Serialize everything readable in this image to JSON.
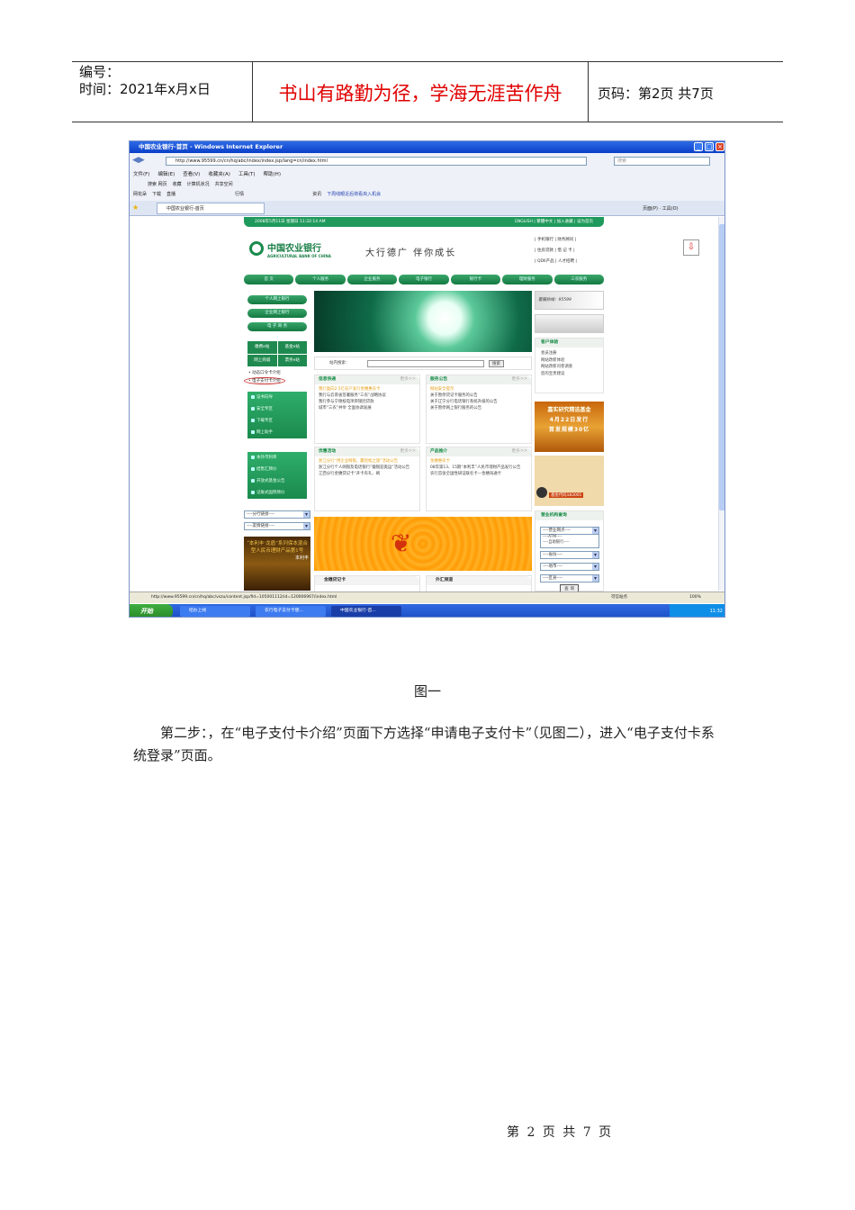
{
  "header": {
    "number_label": "编号：",
    "date_label": "时间：2021年x月x日",
    "motto": "书山有路勤为径，学海无涯苦作舟",
    "page_info": "页码：第2页  共7页"
  },
  "screenshot": {
    "window_title": "中国农业银行-首页 - Windows Internet Explorer",
    "address": "http://www.95599.cn/cn/hq/abc/index/index.jsp/lang=cn/index.html",
    "search_placeholder": "搜索",
    "menu": [
      "文件(F)",
      "编辑(E)",
      "查看(V)",
      "收藏夹(A)",
      "工具(T)",
      "帮助(H)"
    ],
    "toolbar1": [
      "搜索 网页",
      "收藏",
      "计算机状况",
      "共享空间"
    ],
    "toolbar2": [
      "网花朵",
      "下载",
      "直播",
      "行情",
      "资讯",
      "下周线眼近后将看央入机会"
    ],
    "tab_label": "中国农业银行-首页",
    "tab_tools": "页面(P) · 工具(O)",
    "topbar_date": "2008年5月11日 星期日 11:32:14 AM",
    "topbar_links": "ENGLISH | 繁體中文 | 加入收藏 | 设为首页",
    "logo_cn": "中国农业银行",
    "logo_en": "AGRICULTURAL BANK OF CHINA",
    "slogan": "大行德广  伴你成长",
    "top_links": [
      "| 手机银行 | 财务顾问 |",
      "| 住房贷款 | 借 记 卡 |",
      "| QDII产品 | 人才招聘 |"
    ],
    "nav": [
      "首 页",
      "个人服务",
      "企业服务",
      "电子银行",
      "银行卡",
      "理财服务",
      "三农服务"
    ],
    "left_buttons": [
      "个人网上银行",
      "企业网上银行",
      "电 子 商 务"
    ],
    "left_grid": [
      "缴费e站",
      "基金e站",
      "网上商城",
      "票务e站"
    ],
    "left_links": [
      "• 动态口令卡介绍",
      "• 电子支付卡介绍"
    ],
    "left_panel1": [
      "证书向导",
      "安全专区",
      "下载专区",
      "网上助手"
    ],
    "left_panel2": [
      "本外币利率",
      "结售汇牌价",
      "开放式基金公告",
      "记账式国债牌价"
    ],
    "left_selects": [
      "----分行链接----",
      "----友情链接----"
    ],
    "left_ad": "“本利丰·龙盾”系列保本混合型人民币理财产品第1号",
    "left_ad_brand": "本利丰",
    "site_search_label": "站内搜索：",
    "search_button": "搜索",
    "more": "更多>>",
    "boxes": [
      {
        "title": "信息快递",
        "items": [
          "我行面向2.5亿农户发行金穗惠农卡",
          "我行与云南省签署服务“三农”战略协议",
          "我行参与宁德核电项目银团贷款",
          "城市“三农”并举 全面协调发展"
        ]
      },
      {
        "title": "服务公告",
        "items": [
          "网站安全提示",
          "关于暂停贷记卡服务的公告",
          "关于辽宁分行电话银行系统升级的公告",
          "关于暂停网上银行服务的公告"
        ]
      },
      {
        "title": "优惠活动",
        "items": [
          "浙江分行“用企业网银，赢轻松之旅”活动公告",
          "浙江分行个人网银及电话银行“徽银迎奥运”活动公告",
          "江西分行金穗贷记卡“开卡有礼、刷"
        ]
      },
      {
        "title": "产品推介",
        "items": [
          "金穗惠农卡",
          "08年第13、15期“本利丰”人民币理财产品发行公告",
          "农行首张全国性研证联名卡—金穗海通卡"
        ]
      }
    ],
    "bottom_boxes": [
      "金穗贷记卡",
      "外汇频道"
    ],
    "hotline": "客服热线：95599",
    "experience_title": "客户体验",
    "experience_items": [
      "会员注册",
      "网站改新体验",
      "网站改新问卷调查",
      "您的宝贵建议"
    ],
    "fund_ad": [
      "嘉实研究精选基金",
      "4月22日发行",
      "首发规模30亿"
    ],
    "fund_code": "基金代码183001",
    "branch_title": "营业机构查询",
    "branch_selects": [
      "----营业网点----",
      "----ATM----",
      "----自助银行----",
      "----省份----",
      "----地市----",
      "----区县----"
    ],
    "query_button": "查 询",
    "status_url": "http://www.95599.cn/cn/hq/abc/vszu/content.jsp/fid=105001112/id=120006967/index.html",
    "status_zone": "可信站点",
    "zoom": "100%",
    "start": "开始",
    "tasks": [
      "招办上线",
      "农行电子支付卡使...",
      "中国农业银行-首..."
    ],
    "clock": "11:32"
  },
  "caption": "图一",
  "paragraph": "第二步：，在“电子支付卡介绍”页面下方选择“申请电子支付卡”（见图二），进入“电子支付卡系统登录”页面。",
  "footer": "第 2 页 共 7 页"
}
